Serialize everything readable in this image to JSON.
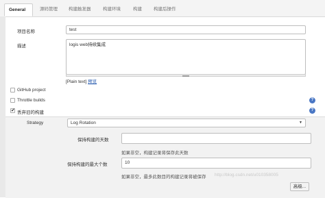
{
  "tabs": [
    {
      "label": "General",
      "active": true
    },
    {
      "label": "源码管理",
      "active": false
    },
    {
      "label": "构建触发器",
      "active": false
    },
    {
      "label": "构建环境",
      "active": false
    },
    {
      "label": "构建",
      "active": false
    },
    {
      "label": "构建后操作",
      "active": false
    }
  ],
  "general": {
    "project_name_label": "项目名称",
    "project_name_value": "test",
    "description_label": "描述",
    "description_value": "logis web持续集成",
    "plain_text_label": "[Plain text]",
    "preview_link": "预览"
  },
  "options": [
    {
      "label": "GitHub project",
      "checked": false,
      "help": false
    },
    {
      "label": "Throttle builds",
      "checked": false,
      "help": true
    },
    {
      "label": "丢弃旧的构建",
      "checked": true,
      "help": true
    }
  ],
  "discard": {
    "strategy_label": "Strategy",
    "strategy_value": "Log Rotation",
    "days_label": "保持构建的天数",
    "days_value": "",
    "days_hint": "如果非空，构建记录将保存此天数",
    "max_label": "保持构建的最大个数",
    "max_value": "10",
    "max_hint": "如果非空，最多此数目的构建记录将被保存",
    "advanced_button": "高级..."
  },
  "icons": {
    "help": "question-mark-icon",
    "dropdown": "chevron-down-icon",
    "check": "checkmark-icon"
  },
  "help_glyph": "?",
  "dropdown_glyph": "▼",
  "watermark": "http://blog.csdn.net/u010358005",
  "colors": {
    "help_blue": "#4a77c4",
    "link_blue": "#2a5db0",
    "section_bg": "#f2f2f2"
  }
}
